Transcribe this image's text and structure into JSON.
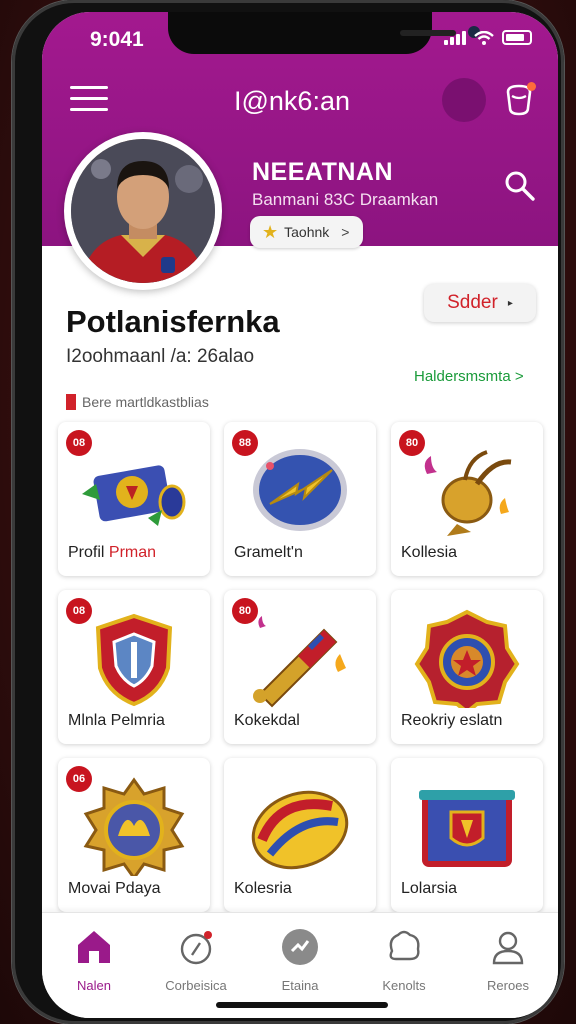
{
  "status_bar": {
    "time": "9:041"
  },
  "header": {
    "app_title": "I@nk6:an"
  },
  "profile": {
    "name": "NEEATNAN",
    "subtitle": "Banmani 83C Draamkan",
    "rank_label": "Taohnk"
  },
  "section": {
    "title": "Potlanisfernka",
    "select_label": "Sdder",
    "subtitle": "I2oohmaanl /a: 26alao",
    "link_label": "Haldersmsmta >",
    "filter_label": "Bere martldkastblias"
  },
  "items": [
    {
      "badge": "08",
      "label": "Profil ",
      "label_accent": "Prman",
      "icon": "scroll-icon"
    },
    {
      "badge": "88",
      "label": "Gramelt'n",
      "label_accent": "",
      "icon": "lightning-shield-icon"
    },
    {
      "badge": "80",
      "label": "Kollesia",
      "label_accent": "",
      "icon": "horn-icon"
    },
    {
      "badge": "08",
      "label": "Mlnla Pelmria",
      "label_accent": "",
      "icon": "shield-icon"
    },
    {
      "badge": "80",
      "label": "Kokekdal",
      "label_accent": "",
      "icon": "torch-icon"
    },
    {
      "badge": "",
      "label": "Reokriy eslatn",
      "label_accent": "",
      "icon": "emblem-icon"
    },
    {
      "badge": "06",
      "label": "Movai Pdaya",
      "label_accent": "",
      "icon": "wheel-emblem-icon"
    },
    {
      "badge": "",
      "label": "Kolesria",
      "label_accent": "",
      "icon": "ball-icon"
    },
    {
      "badge": "",
      "label": "Lolarsia",
      "label_accent": "",
      "icon": "banner-icon"
    }
  ],
  "nav": [
    {
      "label": "Nalen",
      "icon": "home-icon"
    },
    {
      "label": "Corbeisica",
      "icon": "compass-icon"
    },
    {
      "label": "Etaina",
      "icon": "activity-icon"
    },
    {
      "label": "Kenolts",
      "icon": "chat-icon"
    },
    {
      "label": "Reroes",
      "icon": "profile-icon"
    }
  ],
  "colors": {
    "header_bg": "#a3198f",
    "accent_red": "#c8141f",
    "link_green": "#1a9b3a",
    "nav_active": "#9a1a8a"
  }
}
